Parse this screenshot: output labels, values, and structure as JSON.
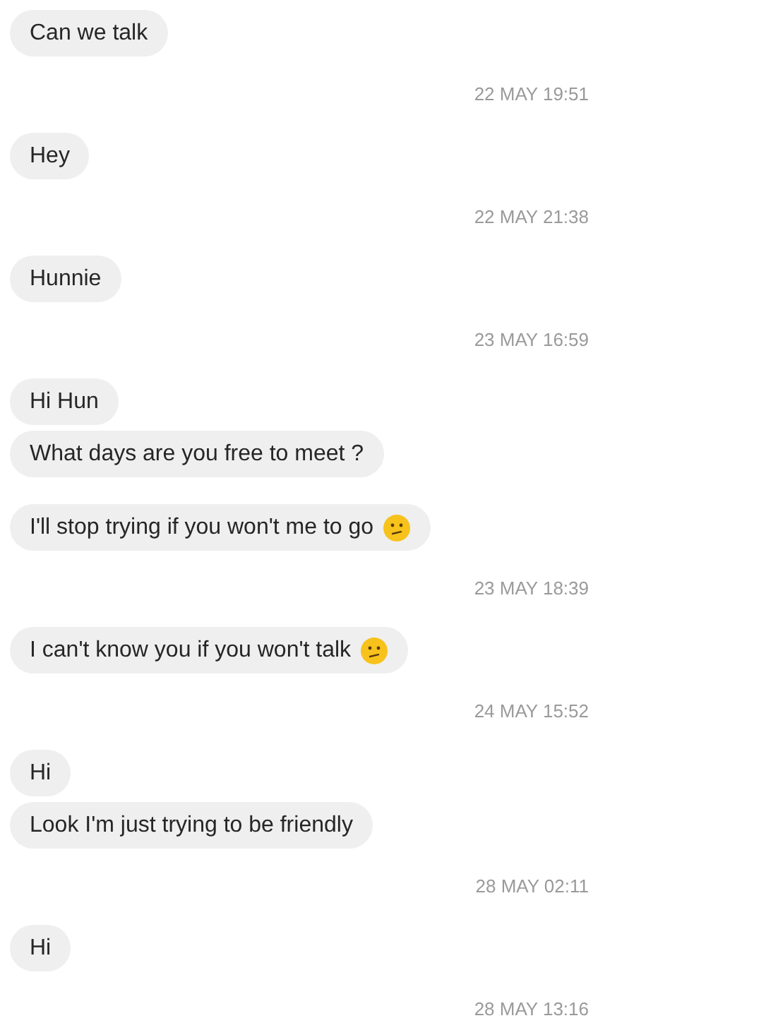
{
  "conversation": [
    {
      "kind": "messages",
      "messages": [
        {
          "text": "Can we talk"
        }
      ]
    },
    {
      "kind": "timestamp",
      "text": "22 MAY 19:51"
    },
    {
      "kind": "messages",
      "messages": [
        {
          "text": "Hey"
        }
      ]
    },
    {
      "kind": "timestamp",
      "text": "22 MAY 21:38"
    },
    {
      "kind": "messages",
      "messages": [
        {
          "text": "Hunnie"
        }
      ]
    },
    {
      "kind": "timestamp",
      "text": "23 MAY 16:59"
    },
    {
      "kind": "messages",
      "messages": [
        {
          "text": "Hi Hun"
        },
        {
          "text": "What days are you free to meet ?"
        }
      ]
    },
    {
      "kind": "messages",
      "messages": [
        {
          "text": "I'll stop trying if you won't me to go",
          "emoji": true
        }
      ]
    },
    {
      "kind": "timestamp",
      "text": "23 MAY 18:39"
    },
    {
      "kind": "messages",
      "messages": [
        {
          "text": "I can't know you if you won't talk",
          "emoji": true
        }
      ]
    },
    {
      "kind": "timestamp",
      "text": "24 MAY 15:52"
    },
    {
      "kind": "messages",
      "messages": [
        {
          "text": "Hi"
        },
        {
          "text": "Look I'm just trying to be friendly"
        }
      ]
    },
    {
      "kind": "timestamp",
      "text": "28 MAY 02:11"
    },
    {
      "kind": "messages",
      "messages": [
        {
          "text": "Hi"
        }
      ]
    },
    {
      "kind": "timestamp",
      "text": "28 MAY 13:16"
    }
  ]
}
